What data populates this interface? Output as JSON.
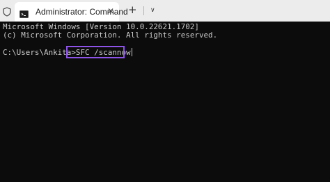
{
  "window": {
    "tab": {
      "title": "Administrator: Command",
      "close_glyph": "✕",
      "icon": "terminal-icon"
    },
    "new_tab_glyph": "+",
    "dropdown_glyph": "∨",
    "shield_icon": "shield-icon"
  },
  "console": {
    "lines": [
      "Microsoft Windows [Version 10.0.22621.1702]",
      "(c) Microsoft Corporation. All rights reserved."
    ],
    "prompt": "C:\\Users\\Ankita",
    "command": ">SFC /scannow"
  },
  "colors": {
    "console_bg": "#0c0c0c",
    "console_text": "#cccccc",
    "highlight": "#8e54e9",
    "titlebar_bg": "#ececec",
    "tab_bg": "#ffffff"
  }
}
